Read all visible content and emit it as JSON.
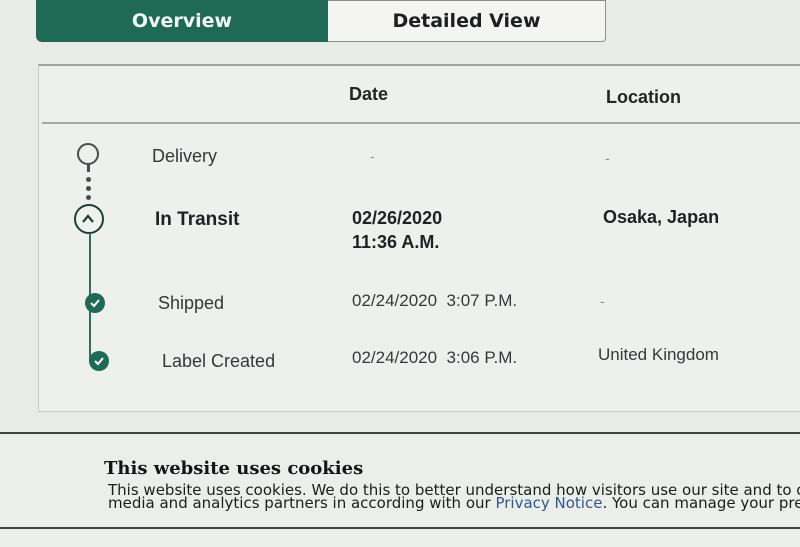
{
  "tabs": {
    "overview": "Overview",
    "detailed": "Detailed View"
  },
  "table": {
    "headers": {
      "date": "Date",
      "location": "Location"
    },
    "rows": [
      {
        "status": "Delivery",
        "date": "-",
        "time": "",
        "location": "-"
      },
      {
        "status": "In Transit",
        "date": "02/26/2020",
        "time": "11:36 A.M.",
        "location": "Osaka, Japan"
      },
      {
        "status": "Shipped",
        "date": "02/24/2020  3:07 P.M.",
        "time": "",
        "location": "-"
      },
      {
        "status": "Label Created",
        "date": "02/24/2020  3:06 P.M.",
        "time": "",
        "location": "United Kingdom"
      }
    ]
  },
  "cookie": {
    "title": "This website uses cookies",
    "line1": "This website uses cookies. We do this to better understand how visitors use our site and to offe",
    "line2_before": "media and analytics partners in according with our ",
    "link": "Privacy Notice",
    "line2_after": ". You can manage your prefere"
  },
  "colors": {
    "accent": "#1e6a55",
    "link": "#2d5a8a"
  },
  "icons": {
    "delivery": "empty-circle-pin",
    "transit": "chevron-up-circle",
    "completed": "checkmark-circle"
  }
}
